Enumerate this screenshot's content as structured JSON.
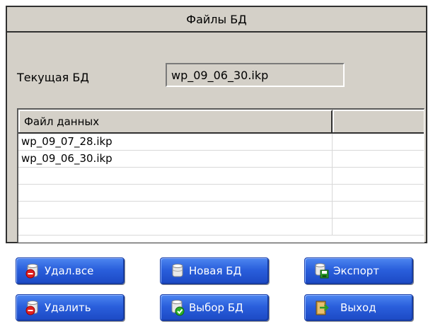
{
  "panel": {
    "title": "Файлы БД",
    "current_db_label": "Текущая БД",
    "current_db_value": "wp_09_06_30.ikp"
  },
  "table": {
    "columns": [
      "Файл данных",
      ""
    ],
    "rows": [
      "wp_09_07_28.ikp",
      "wp_09_06_30.ikp",
      "",
      "",
      "",
      ""
    ]
  },
  "buttons": {
    "delete_all": "Удал.все",
    "new_db": "Новая БД",
    "export": "Экспорт",
    "delete": "Удалить",
    "select_db": "Выбор БД",
    "exit": "Выход"
  },
  "icons": {
    "delete_all": "db-delete-icon",
    "new_db": "db-new-icon",
    "export": "db-export-icon",
    "delete": "db-remove-icon",
    "select_db": "db-select-icon",
    "exit": "exit-door-icon"
  }
}
